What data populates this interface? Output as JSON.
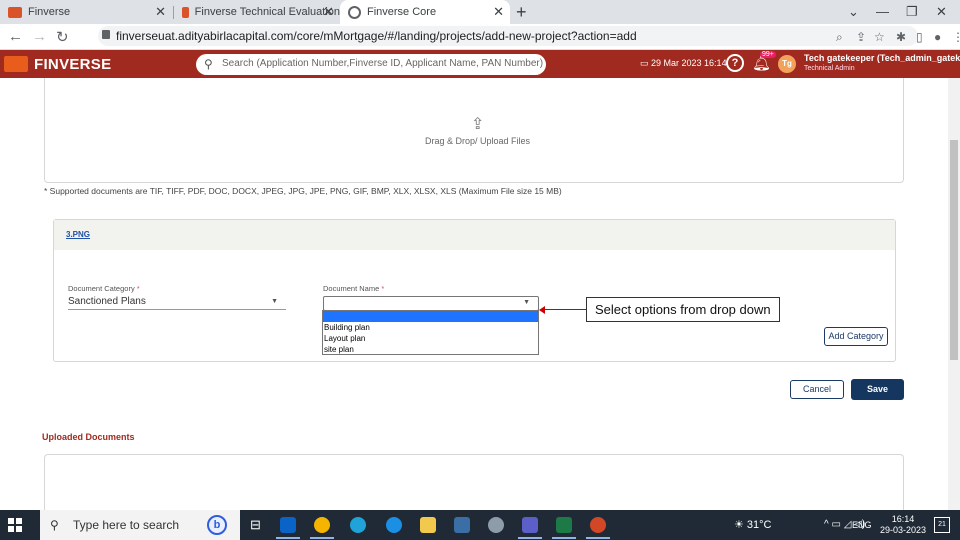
{
  "browser": {
    "tabs": [
      {
        "label": "Finverse"
      },
      {
        "label": "Finverse Technical Evaluation"
      },
      {
        "label": "Finverse Core"
      }
    ],
    "new_tab": "+",
    "url": "finverseuat.adityabirlacapital.com/core/mMortgage/#/landing/projects/add-new-project?action=add"
  },
  "app_header": {
    "brand": "FINVERSE",
    "search_placeholder": "Search (Application Number,Finverse ID, Applicant Name, PAN Number)",
    "datetime": "29 Mar 2023 16:14",
    "notification_badge": "99+",
    "avatar_initials": "Tg",
    "user_name": "Tech gatekeeper (Tech_admin_gatekee",
    "user_role": "Technical Admin"
  },
  "upload": {
    "drop_text": "Drag & Drop/ Upload Files",
    "supported_note": "* Supported documents are TIF, TIFF, PDF, DOC, DOCX, JPEG, JPG, JPE, PNG, GIF, BMP, XLX, XLSX, XLS (Maximum File size 15 MB)"
  },
  "document_card": {
    "file_name": "3.PNG",
    "category_label": "Document Category",
    "category_value": "Sanctioned Plans",
    "name_label": "Document Name",
    "required_mark": "*",
    "dropdown_options": [
      "",
      "Building plan",
      "Layout plan",
      "site plan"
    ],
    "add_category_label": "Add Category"
  },
  "annotation": {
    "callout_text": "Select options from drop down"
  },
  "actions": {
    "cancel_label": "Cancel",
    "save_label": "Save"
  },
  "uploaded_documents": {
    "title": "Uploaded Documents"
  },
  "taskbar": {
    "search_placeholder": "Type here to search",
    "weather": "31°C",
    "lang": "ENG",
    "time": "16:14",
    "date": "29-03-2023",
    "notification_count": "21"
  },
  "colors": {
    "brand_header": "#a02a1f",
    "primary_button": "#14365f",
    "selected_option": "#1e74ff",
    "callout_arrow": "#cc0000"
  }
}
